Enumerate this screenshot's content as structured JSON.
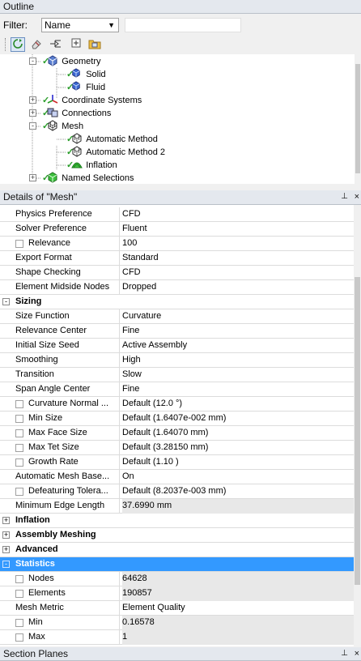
{
  "outline": {
    "title": "Outline",
    "filter_label": "Filter:",
    "filter_value": "Name",
    "filter_text": "",
    "toolbar": [
      "refresh-icon",
      "eraser-icon",
      "expand-tree-icon",
      "expand-all-icon",
      "folder-icon"
    ],
    "tree": [
      {
        "label": "Geometry",
        "icon": "geometry-icon",
        "check": true,
        "expander": "-"
      },
      {
        "label": "Solid",
        "icon": "body-icon",
        "check": true,
        "expander": ""
      },
      {
        "label": "Fluid",
        "icon": "body-icon",
        "check": true,
        "expander": ""
      },
      {
        "label": "Coordinate Systems",
        "icon": "coordinate-icon",
        "check": true,
        "expander": "+"
      },
      {
        "label": "Connections",
        "icon": "connections-icon",
        "check": true,
        "expander": "+"
      },
      {
        "label": "Mesh",
        "icon": "mesh-icon",
        "check": true,
        "expander": "-"
      },
      {
        "label": "Automatic Method",
        "icon": "method-icon",
        "check": true,
        "expander": ""
      },
      {
        "label": "Automatic Method 2",
        "icon": "method-icon",
        "check": true,
        "expander": ""
      },
      {
        "label": "Inflation",
        "icon": "inflation-icon",
        "check": true,
        "expander": ""
      },
      {
        "label": "Named Selections",
        "icon": "named-selection-icon",
        "check": true,
        "expander": "+"
      }
    ]
  },
  "details": {
    "title": "Details of \"Mesh\"",
    "pin": "⊥",
    "close": "×",
    "rows": [
      {
        "type": "prop",
        "name": "Physics Preference",
        "value": "CFD"
      },
      {
        "type": "prop",
        "name": "Solver Preference",
        "value": "Fluent"
      },
      {
        "type": "prop",
        "name": "Relevance",
        "value": "100",
        "checkbox": true
      },
      {
        "type": "prop",
        "name": "Export Format",
        "value": "Standard"
      },
      {
        "type": "prop",
        "name": "Shape Checking",
        "value": "CFD"
      },
      {
        "type": "prop",
        "name": "Element Midside Nodes",
        "value": "Dropped"
      },
      {
        "type": "group",
        "name": "Sizing",
        "expander": "-"
      },
      {
        "type": "prop",
        "name": "Size Function",
        "value": "Curvature"
      },
      {
        "type": "prop",
        "name": "Relevance Center",
        "value": "Fine"
      },
      {
        "type": "prop",
        "name": "Initial Size Seed",
        "value": "Active Assembly"
      },
      {
        "type": "prop",
        "name": "Smoothing",
        "value": "High"
      },
      {
        "type": "prop",
        "name": "Transition",
        "value": "Slow"
      },
      {
        "type": "prop",
        "name": "Span Angle Center",
        "value": "Fine"
      },
      {
        "type": "prop",
        "name": "Curvature Normal ...",
        "value": "Default (12.0 °)",
        "checkbox": true
      },
      {
        "type": "prop",
        "name": "Min Size",
        "value": "Default (1.6407e-002 mm)",
        "checkbox": true
      },
      {
        "type": "prop",
        "name": "Max Face Size",
        "value": "Default (1.64070 mm)",
        "checkbox": true
      },
      {
        "type": "prop",
        "name": "Max Tet Size",
        "value": "Default (3.28150 mm)",
        "checkbox": true
      },
      {
        "type": "prop",
        "name": "Growth Rate",
        "value": "Default (1.10 )",
        "checkbox": true
      },
      {
        "type": "prop",
        "name": "Automatic Mesh Base...",
        "value": "On"
      },
      {
        "type": "prop",
        "name": "Defeaturing Tolera...",
        "value": "Default (8.2037e-003 mm)",
        "checkbox": true
      },
      {
        "type": "prop",
        "name": "Minimum Edge Length",
        "value": "37.6990 mm",
        "gray": true
      },
      {
        "type": "group",
        "name": "Inflation",
        "expander": "+"
      },
      {
        "type": "group",
        "name": "Assembly Meshing",
        "expander": "+"
      },
      {
        "type": "group",
        "name": "Advanced",
        "expander": "+"
      },
      {
        "type": "group",
        "name": "Statistics",
        "expander": "-",
        "selected": true
      },
      {
        "type": "prop",
        "name": "Nodes",
        "value": "64628",
        "checkbox": true,
        "gray": true
      },
      {
        "type": "prop",
        "name": "Elements",
        "value": "190857",
        "checkbox": true,
        "gray": true
      },
      {
        "type": "prop",
        "name": "Mesh Metric",
        "value": "Element Quality"
      },
      {
        "type": "prop",
        "name": "Min",
        "value": "0.16578",
        "checkbox": true,
        "gray": true
      },
      {
        "type": "prop",
        "name": "Max",
        "value": "1",
        "checkbox": true,
        "gray": true
      }
    ]
  },
  "section_planes": {
    "title": "Section Planes",
    "pin": "⊥",
    "close": "×"
  }
}
